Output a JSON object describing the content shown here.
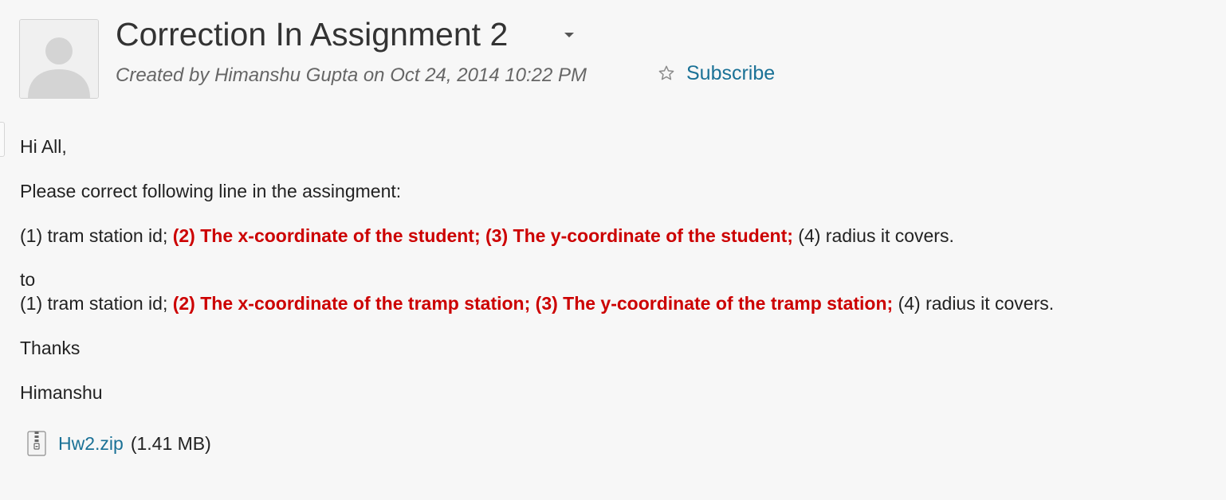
{
  "post": {
    "title": "Correction In Assignment 2",
    "created_by": "Created by Himanshu Gupta on Oct 24, 2014 10:22 PM",
    "subscribe_label": "Subscribe",
    "icons": {
      "avatar": "default-user-avatar",
      "menu": "caret-down-icon",
      "subscribe": "star-outline-icon",
      "attachment": "zip-file-icon"
    },
    "accent_color": "#1a7196",
    "highlight_color": "#cc0000"
  },
  "message": {
    "greeting": "Hi All,",
    "intro": "Please correct following line in the assingment:",
    "original_line": {
      "part1": "(1) tram station id; ",
      "part2": "(2) The x-coordinate of the student; ",
      "part3": "(3) The y-coordinate of the student;",
      "part4": " (4) radius it covers."
    },
    "to_label": "to",
    "corrected_line": {
      "part1": "(1) tram station id; ",
      "part2": "(2) The x-coordinate of the tramp station; ",
      "part3": "(3) The y-coordinate of the tramp station;",
      "part4": " (4) radius it covers."
    },
    "thanks": "Thanks",
    "signature": "Himanshu"
  },
  "attachment": {
    "file_name": "Hw2.zip",
    "file_size": "(1.41 MB)"
  }
}
